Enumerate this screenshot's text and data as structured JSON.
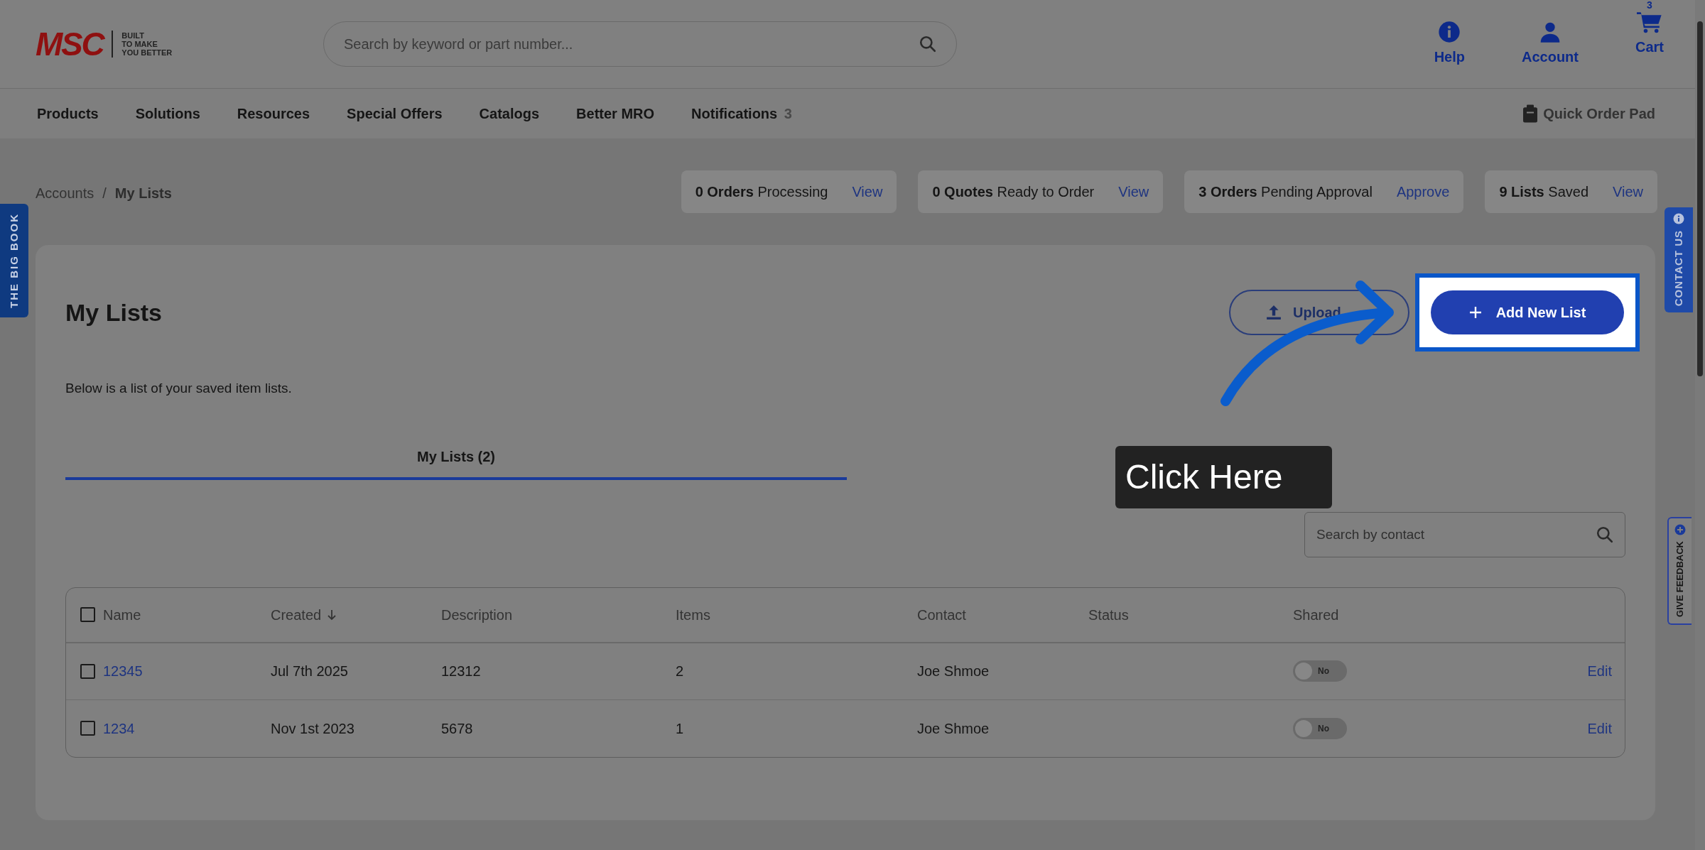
{
  "header": {
    "logo": {
      "brand": "MSC",
      "tagline": [
        "BUILT",
        "TO MAKE",
        "YOU BETTER"
      ]
    },
    "search": {
      "placeholder": "Search by keyword or part number..."
    },
    "actions": [
      {
        "kind": "help",
        "label": "Help"
      },
      {
        "kind": "account",
        "label": "Account"
      },
      {
        "kind": "cart",
        "label": "Cart",
        "badge": "3"
      }
    ]
  },
  "nav": {
    "items": [
      {
        "label": "Products"
      },
      {
        "label": "Solutions"
      },
      {
        "label": "Resources"
      },
      {
        "label": "Special Offers"
      },
      {
        "label": "Catalogs"
      },
      {
        "label": "Better MRO"
      },
      {
        "label": "Notifications",
        "badge": "3"
      }
    ],
    "quick_order": "Quick Order Pad"
  },
  "breadcrumb": {
    "separator": "/",
    "items": [
      {
        "label": "Accounts",
        "current": false
      },
      {
        "label": "My Lists",
        "current": true
      }
    ]
  },
  "stats": [
    {
      "text": "**0 Orders** Processing",
      "action": "View"
    },
    {
      "text": "**0 Quotes** Ready to Order",
      "action": "View"
    },
    {
      "text": "**3 Orders** Pending Approval",
      "action": "Approve"
    },
    {
      "text": "**9 Lists** Saved",
      "action": "View"
    }
  ],
  "side_tabs": {
    "left": "THE BIG BOOK",
    "contact": "CONTACT US",
    "feedback": "GIVE FEEDBACK"
  },
  "page": {
    "title": "My Lists",
    "upload_button": "Upload",
    "add_button": "Add New List",
    "description": "Below is a list of your saved item lists.",
    "tabs": [
      {
        "label": "My Lists (2)",
        "selected": true
      }
    ],
    "search": {
      "placeholder": "Search by contact"
    },
    "table": {
      "select_all": false,
      "columns": [
        {
          "label": "Name",
          "sorted": false
        },
        {
          "label": "Created",
          "sorted": true
        },
        {
          "label": "Description",
          "sorted": false
        },
        {
          "label": "Items",
          "sorted": false
        },
        {
          "label": "Contact",
          "sorted": false
        },
        {
          "label": "Status",
          "sorted": false
        },
        {
          "label": "Shared",
          "sorted": false
        }
      ],
      "rows": [
        {
          "checked": false,
          "name": "12345",
          "created": "Jul 7th 2025",
          "description": "12312",
          "items": "2",
          "contact": "Joe Shmoe",
          "shared": false,
          "shared_label": "No",
          "action": "Edit"
        },
        {
          "checked": false,
          "name": "1234",
          "created": "Nov 1st 2023",
          "description": "5678",
          "items": "1",
          "contact": "Joe Shmoe",
          "shared": false,
          "shared_label": "No",
          "action": "Edit"
        }
      ]
    }
  },
  "callout": {
    "text": "Click Here"
  }
}
